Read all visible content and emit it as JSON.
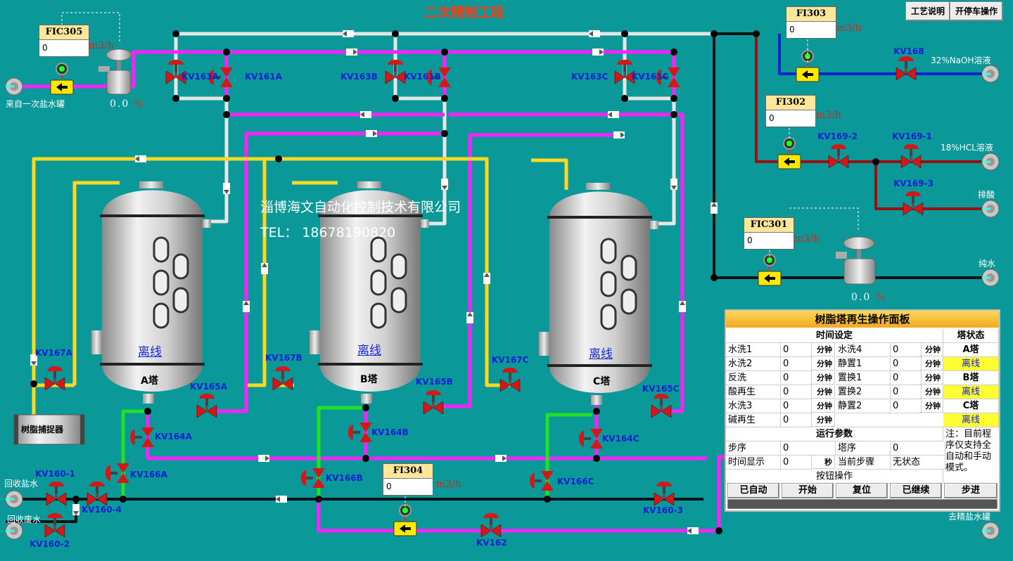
{
  "title": "二次精制工段",
  "top_buttons": {
    "process_desc": "工艺说明",
    "start_stop": "开停车操作"
  },
  "instruments": {
    "FIC305": {
      "tag": "FIC305",
      "value": "0",
      "unit": "m3/h"
    },
    "FI303": {
      "tag": "FI303",
      "value": "0",
      "unit": "m3/h"
    },
    "FI302": {
      "tag": "FI302",
      "value": "0",
      "unit": "m3/h"
    },
    "FIC301": {
      "tag": "FIC301",
      "value": "0",
      "unit": "m3/h"
    },
    "FI304": {
      "tag": "FI304",
      "value": "0",
      "unit": "m3/h"
    }
  },
  "valve_pct": {
    "cv305": "0.0",
    "cv301": "0.0",
    "pct_sign": "%"
  },
  "valves": [
    "KV163A",
    "KV161A",
    "KV163B",
    "KV161B",
    "KV163C",
    "KV161C",
    "KV168",
    "KV169-2",
    "KV169-1",
    "KV169-3",
    "KV167A",
    "KV167B",
    "KV167C",
    "KV165A",
    "KV165B",
    "KV165C",
    "KV164A",
    "KV164B",
    "KV164C",
    "KV166A",
    "KV166B",
    "KV166C",
    "KV160-1",
    "KV160-4",
    "KV160-2",
    "KV160-3",
    "KV162"
  ],
  "streams": {
    "inlet": "来自一次盐水罐",
    "naoh": "32%NaOH溶液",
    "hcl": "18%HCL溶液",
    "acid_drain": "排酸",
    "pure_water": "纯水",
    "recycle_brine": "回收盐水",
    "recycle_waste": "回收废水",
    "to_fine_tank": "去精盐水罐"
  },
  "towers": [
    {
      "name": "A塔",
      "status": "离线"
    },
    {
      "name": "B塔",
      "status": "离线"
    },
    {
      "name": "C塔",
      "status": "离线"
    }
  ],
  "resin_catcher": "树脂捕捉器",
  "watermark": {
    "company": "淄博海文自动化控制技术有限公司",
    "tel": "TEL：  18678190820"
  },
  "panel": {
    "title": "树脂塔再生操作面板",
    "time_setting": "时间设定",
    "tower_status": "塔状态",
    "unit_min": "分钟",
    "unit_sec": "秒",
    "rows": [
      {
        "l": "水洗1",
        "lv": "0",
        "r": "水洗4",
        "rv": "0",
        "s": "A塔"
      },
      {
        "l": "水洗2",
        "lv": "0",
        "r": "静置1",
        "rv": "0",
        "s": "离线"
      },
      {
        "l": "反洗",
        "lv": "0",
        "r": "置换1",
        "rv": "0",
        "s": "B塔"
      },
      {
        "l": "酸再生",
        "lv": "0",
        "r": "置换2",
        "rv": "0",
        "s": "离线"
      },
      {
        "l": "水洗3",
        "lv": "0",
        "r": "静置2",
        "rv": "0",
        "s": "C塔"
      },
      {
        "l": "碱再生",
        "lv": "0",
        "r": "",
        "rv": "",
        "s": "离线"
      }
    ],
    "run_params": "运行参数",
    "step": "步序",
    "step_val": "0",
    "tower_step": "塔序",
    "tower_step_val": "0",
    "time_display": "时间显示",
    "time_val": "0",
    "current_step": "当前步骤",
    "current_step_val": "无状态",
    "button_ops": "按钮操作",
    "note": "注：目前程序仅支持全自动和手动模式。",
    "buttons": [
      "已自动",
      "开始",
      "复位",
      "已继续",
      "步进"
    ]
  }
}
